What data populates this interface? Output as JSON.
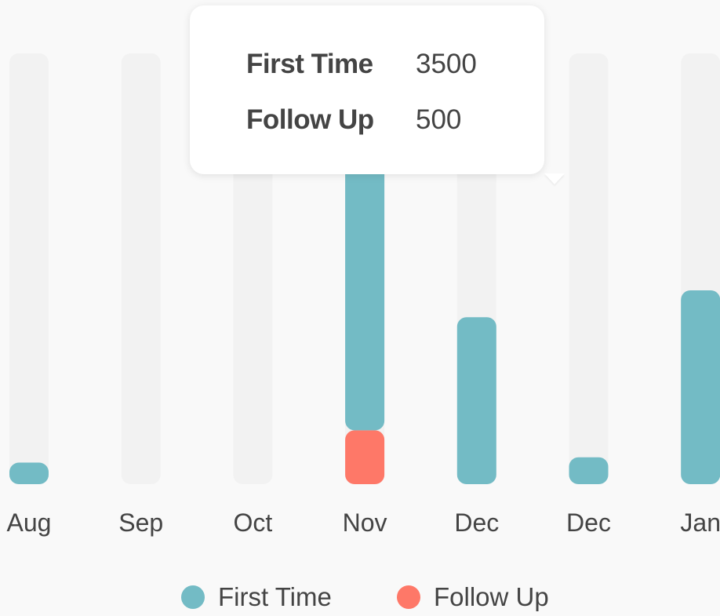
{
  "chart_data": {
    "type": "bar",
    "stacked": true,
    "categories": [
      "Aug",
      "Sep",
      "Oct",
      "Nov",
      "Dec",
      "Dec",
      "Jan"
    ],
    "series": [
      {
        "name": "First Time",
        "color": "#73bbc5",
        "values": [
          200,
          0,
          0,
          3500,
          1550,
          250,
          1800
        ]
      },
      {
        "name": "Follow Up",
        "color": "#fe7868",
        "values": [
          0,
          0,
          0,
          500,
          0,
          0,
          0
        ]
      }
    ],
    "ylim": [
      0,
      4000
    ],
    "track_color": "#f2f2f2",
    "grid": false,
    "legend_position": "bottom"
  },
  "tooltip": {
    "category": "Nov",
    "rows": [
      {
        "label": "First Time",
        "value": "3500"
      },
      {
        "label": "Follow Up",
        "value": "500"
      }
    ]
  },
  "legend": {
    "items": [
      {
        "label": "First Time",
        "color": "#73bbc5"
      },
      {
        "label": "Follow Up",
        "color": "#fe7868"
      }
    ]
  }
}
